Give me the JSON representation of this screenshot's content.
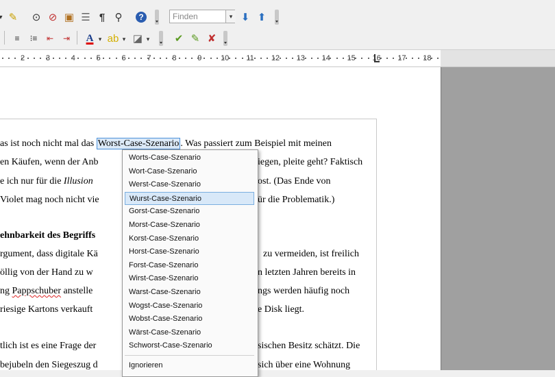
{
  "toolbar1": {
    "find_placeholder": "Finden",
    "icons": [
      "spellcheck-icon",
      "binoculars-icon",
      "navigator-icon",
      "gallery-icon",
      "database-icon",
      "formatting-marks-icon",
      "zoom-icon",
      "help-icon",
      "find-next-icon",
      "find-previous-icon"
    ]
  },
  "toolbar2": {
    "icons": [
      "bulleted-list-icon",
      "numbered-list-icon",
      "decrease-indent-icon",
      "increase-indent-icon",
      "font-color-icon",
      "highlight-icon",
      "background-color-icon",
      "accept-change-icon",
      "next-change-icon",
      "reject-change-icon"
    ]
  },
  "ruler": {
    "numbers": [
      "2",
      "3",
      "4",
      "5",
      "6",
      "7",
      "8",
      "9",
      "10",
      "11",
      "12",
      "13",
      "14",
      "15",
      "16",
      "17",
      "18"
    ]
  },
  "document": {
    "line1_a": "as ist noch nicht mal das ",
    "line1_word": "Worst-Case-Szenario",
    "line1_b": ". Was passiert zum Beispiel mit meinen",
    "line2_a": "en Käufen, wenn der Anb",
    "line2_b": "iegen, pleite geht? Faktisch",
    "line3_a": "e ich nur für die ",
    "line3_italic": "Illusion",
    "line3_b": "ost. (Das Ende von",
    "line4_a": "Violet mag noch nicht vie",
    "line4_b": "ür die Problematik.)",
    "heading": "ehnbarkeit des Begriffs",
    "line5_a": "rgument, dass digitale Kä",
    "line5_b": "zu vermeiden, ist freilich",
    "line6_a": "öllig von der Hand zu w",
    "line6_b": "n letzten Jahren bereits in",
    "line7_a": "ng ",
    "line7_word": "Pappschuber",
    "line7_b": " anstelle",
    "line7_c": "ngs werden häufig noch",
    "line8_a": " riesige Kartons verkauft",
    "line8_b": "e Disk liegt.",
    "line9_a": "tlich ist es eine Frage der",
    "line9_b": "sischen Besitz schätzt. Die",
    "line10_a": "bejubeln den Siegeszug d",
    "line10_b": "sich über eine Wohnung"
  },
  "context_menu": {
    "suggestions": [
      "Worts-Case-Szenario",
      "Wort-Case-Szenario",
      "Werst-Case-Szenario",
      "Wurst-Case-Szenario",
      "Gorst-Case-Szenario",
      "Morst-Case-Szenario",
      "Korst-Case-Szenario",
      "Horst-Case-Szenario",
      "Forst-Case-Szenario",
      "Wirst-Case-Szenario",
      "Warst-Case-Szenario",
      "Wogst-Case-Szenario",
      "Wobst-Case-Szenario",
      "Wärst-Case-Szenario",
      "Schworst-Case-Szenario"
    ],
    "highlighted_index": 3,
    "ignore_label": "Ignorieren"
  },
  "colors": {
    "selection_border": "#4a90d9",
    "spell_underline": "#dd2222",
    "menu_highlight": "#d8e8f8"
  }
}
